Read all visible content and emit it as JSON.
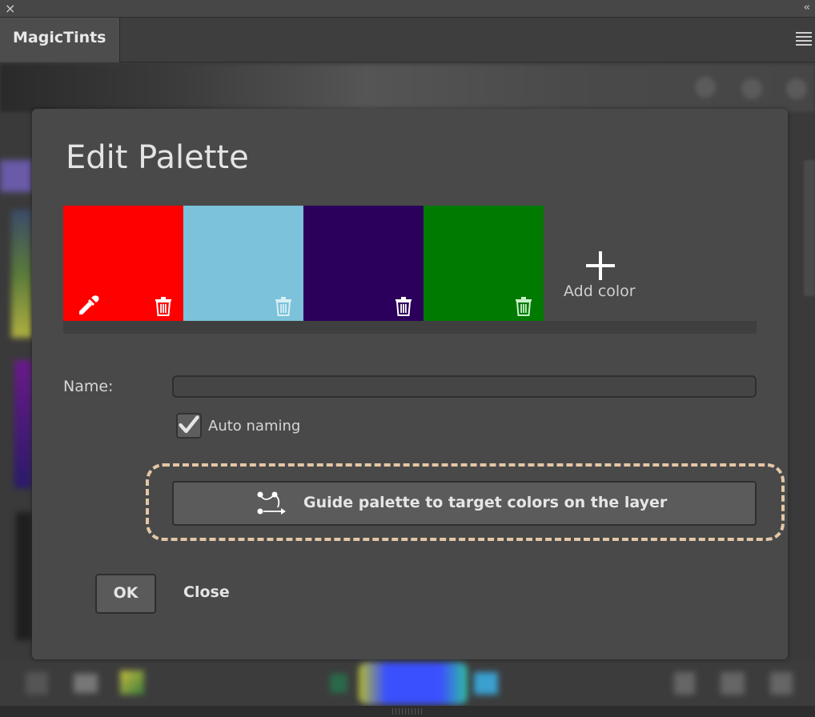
{
  "window": {
    "close_glyph": "×",
    "collapse_glyph": "‹‹",
    "tab_label": "MagicTints"
  },
  "dialog": {
    "title": "Edit Palette",
    "swatches": [
      {
        "color": "#ff0000",
        "has_picker": true
      },
      {
        "color": "#7bc2da",
        "has_picker": false
      },
      {
        "color": "#2a005c",
        "has_picker": false
      },
      {
        "color": "#007a00",
        "has_picker": false
      }
    ],
    "add_color_label": "Add color",
    "name_label": "Name:",
    "name_value": "",
    "auto_naming_label": "Auto naming",
    "auto_naming_checked": true,
    "guide_button_label": "Guide palette to target colors on the layer",
    "ok_label": "OK",
    "close_label": "Close"
  },
  "colors": {
    "dialog_bg": "#494949",
    "highlight_dash": "#e3c7a6"
  }
}
